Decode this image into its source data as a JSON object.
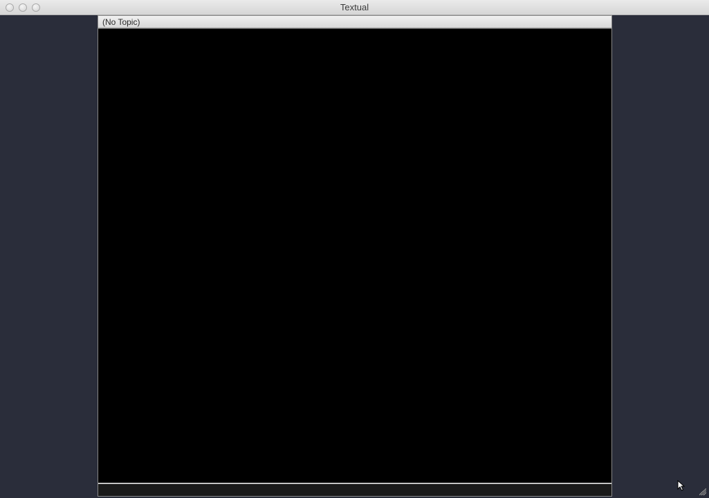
{
  "window": {
    "title": "Textual"
  },
  "topic": {
    "label": "(No Topic)"
  },
  "input": {
    "value": "",
    "placeholder": ""
  }
}
